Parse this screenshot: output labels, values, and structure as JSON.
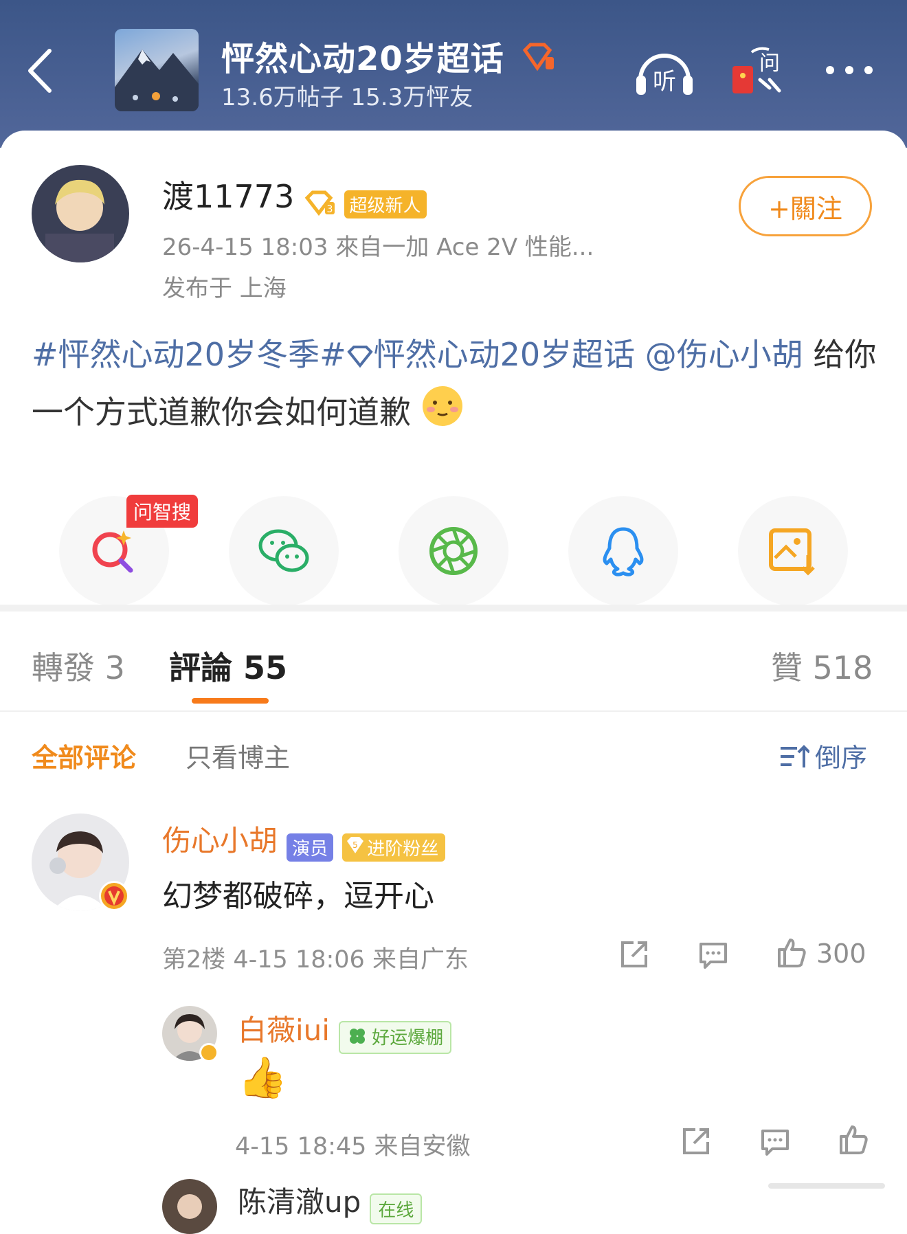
{
  "header": {
    "topic_title": "怦然心动20岁超话",
    "topic_stats": "13.6万帖子 15.3万怦友",
    "listen_label": "听",
    "ask_label": "问"
  },
  "post": {
    "author": "渡11773",
    "level_badge": "3",
    "author_badge": "超级新人",
    "follow_label": "+關注",
    "time_source": "26-4-15 18:03  來自一加 Ace 2V 性能...",
    "location": "发布于 上海",
    "hashtag1": "#怦然心动20岁冬季#",
    "hashtag2": "怦然心动20岁超话",
    "mention": "@伤心小胡",
    "text": " 给你一个方式道歉你会如何道歉"
  },
  "share": {
    "ai_tag": "问智搜",
    "items": [
      "ai-search",
      "wechat",
      "moments",
      "qq",
      "save-image"
    ]
  },
  "tabs": {
    "repost": "轉發 3",
    "comments": "評論 55",
    "likes": "贊 518"
  },
  "filter": {
    "all": "全部评论",
    "author_only": "只看博主",
    "sort": "倒序"
  },
  "comments": [
    {
      "name": "伤心小胡",
      "role_badge": "演员",
      "fan_level": "5",
      "fan_badge": "进阶粉丝",
      "text": "幻梦都破碎，逗开心",
      "meta": "第2楼  4-15 18:06  来自广东",
      "likes": "300"
    },
    {
      "name": "白薇iui",
      "badge": "好运爆棚",
      "text": "👍",
      "meta": "4-15 18:45  来自安徽"
    },
    {
      "name": "陈清澈up",
      "badge": "在线"
    }
  ],
  "colors": {
    "header_bg": "#4a5f92",
    "accent_orange": "#f08a1c",
    "link_blue": "#4e6ea5",
    "name_orange": "#e8782b"
  }
}
